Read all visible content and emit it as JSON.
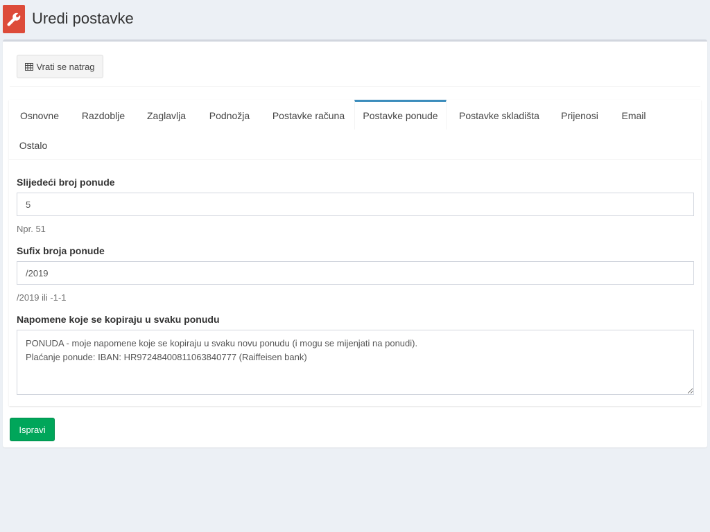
{
  "header": {
    "title": "Uredi postavke",
    "icon": "wrench-icon",
    "icon_color": "#dd4b39"
  },
  "toolbar": {
    "back_label": "Vrati se natrag",
    "back_icon": "table-icon"
  },
  "tabs": [
    {
      "label": "Osnovne",
      "active": false
    },
    {
      "label": "Razdoblje",
      "active": false
    },
    {
      "label": "Zaglavlja",
      "active": false
    },
    {
      "label": "Podnožja",
      "active": false
    },
    {
      "label": "Postavke računa",
      "active": false
    },
    {
      "label": "Postavke ponude",
      "active": true
    },
    {
      "label": "Postavke skladišta",
      "active": false
    },
    {
      "label": "Prijenosi",
      "active": false
    },
    {
      "label": "Email",
      "active": false
    },
    {
      "label": "Ostalo",
      "active": false
    }
  ],
  "form": {
    "next_number": {
      "label": "Slijedeći broj ponude",
      "value": "5",
      "help": "Npr. 51"
    },
    "suffix": {
      "label": "Sufix broja ponude",
      "value": "/2019",
      "help": "/2019 ili -1-1"
    },
    "notes": {
      "label": "Napomene koje se kopiraju u svaku ponudu",
      "value": "PONUDA - moje napomene koje se kopiraju u svaku novu ponudu (i mogu se mijenjati na ponudi).\nPlaćanje ponude: IBAN: HR9724840081106384077​7 (Raiffeisen bank)"
    }
  },
  "actions": {
    "submit_label": "Ispravi"
  },
  "colors": {
    "active_tab": "#3c8dbc",
    "submit": "#00a65a",
    "background": "#ecf0f5"
  }
}
